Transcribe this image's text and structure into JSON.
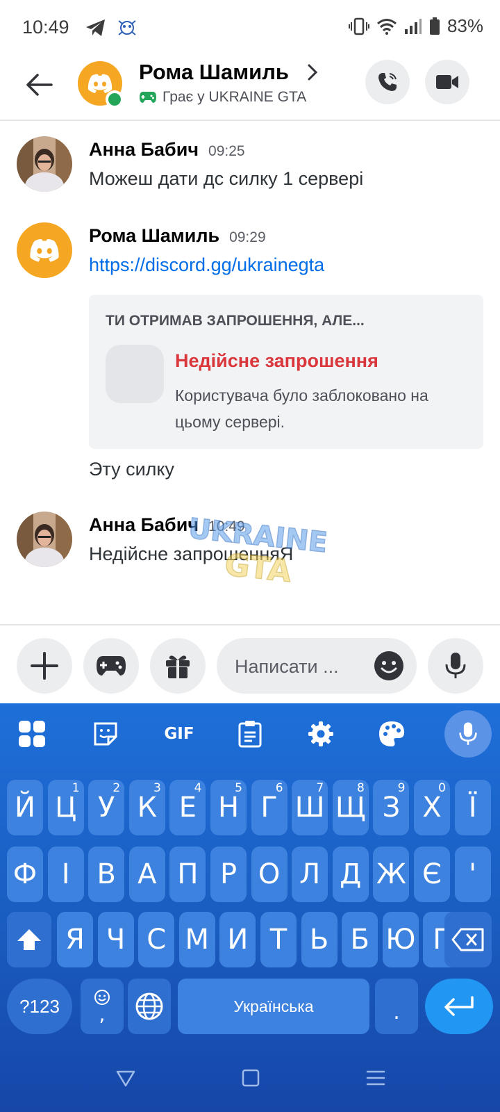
{
  "status_bar": {
    "time": "10:49",
    "battery": "83%"
  },
  "header": {
    "contact_name": "Рома Шамиль",
    "activity": "Грає у UKRAINE GTA"
  },
  "messages": [
    {
      "author": "Анна Бабич",
      "time": "09:25",
      "text": "Можеш дати дс силку 1 сервері"
    },
    {
      "author": "Рома Шамиль",
      "time": "09:29",
      "link": "https://discord.gg/ukrainegta"
    },
    {
      "text": "Эту силку"
    },
    {
      "author": "Анна Бабич",
      "time": "10:49",
      "text": "Недійсне запрошенняЯ"
    }
  ],
  "invite": {
    "title": "ТИ ОТРИМАВ ЗАПРОШЕННЯ, АЛЕ...",
    "status": "Недійсне запрошення",
    "description": "Користувача було заблоковано на цьому сервері."
  },
  "watermark": {
    "line1": "UKRAINE",
    "line2": "GTA"
  },
  "composer": {
    "placeholder": "Написати ..."
  },
  "keyboard": {
    "toolbar_gif": "GIF",
    "rows": [
      [
        "Й",
        "Ц",
        "У",
        "К",
        "Е",
        "Н",
        "Г",
        "Ш",
        "Щ",
        "З",
        "Х",
        "Ї"
      ],
      [
        "Ф",
        "І",
        "В",
        "А",
        "П",
        "Р",
        "О",
        "Л",
        "Д",
        "Ж",
        "Є",
        "'"
      ],
      [
        "Я",
        "Ч",
        "С",
        "М",
        "И",
        "Т",
        "Ь",
        "Б",
        "Ю",
        "Ґ"
      ]
    ],
    "hints": [
      "1",
      "2",
      "3",
      "4",
      "5",
      "6",
      "7",
      "8",
      "9",
      "0"
    ],
    "symbols_key": "?123",
    "comma_key": ",",
    "space_label": "Українська",
    "period_key": "."
  },
  "colors": {
    "accent_link": "#006ce7",
    "error": "#da373c",
    "online": "#23a55a",
    "discord_avatar": "#f5a623",
    "keyboard_bg": "#1e6fd9",
    "key_bg": "#3e82e0"
  }
}
